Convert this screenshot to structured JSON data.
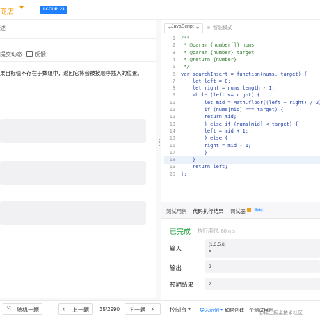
{
  "header": {
    "store_label": "商店",
    "badge": "LCCUP' 23"
  },
  "left": {
    "tab_stub": "述",
    "submissions_tab": "提交动态",
    "feedback_tab": "反馈",
    "description": "果目标值不存在于数组中，返回它将会被按顺序插入的位置。"
  },
  "editor": {
    "language": "JavaScript",
    "smart_mode": "智能模式",
    "lines": [
      {
        "n": "1",
        "text": "/**",
        "cls": "cmt"
      },
      {
        "n": "2",
        "text": " * @param {number[]} nums",
        "cls": "cmt"
      },
      {
        "n": "3",
        "text": " * @param {number} target",
        "cls": "cmt"
      },
      {
        "n": "4",
        "text": " * @return {number}",
        "cls": "cmt"
      },
      {
        "n": "5",
        "text": " */",
        "cls": "cmt"
      },
      {
        "n": "6",
        "text": "var searchInsert = function(nums, target) {",
        "cls": ""
      },
      {
        "n": "7",
        "text": "    let left = 0;",
        "cls": ""
      },
      {
        "n": "8",
        "text": "    let right = nums.length - 1;",
        "cls": ""
      },
      {
        "n": "9",
        "text": "    while (left <= right) {",
        "cls": ""
      },
      {
        "n": "10",
        "text": "        let mid = Math.floor((left + right) / 2);",
        "cls": ""
      },
      {
        "n": "11",
        "text": "        if (nums[mid] === target) {",
        "cls": ""
      },
      {
        "n": "12",
        "text": "        return mid;",
        "cls": ""
      },
      {
        "n": "13",
        "text": "        } else if (nums[mid] < target) {",
        "cls": ""
      },
      {
        "n": "14",
        "text": "        left = mid + 1;",
        "cls": ""
      },
      {
        "n": "15",
        "text": "        } else {",
        "cls": ""
      },
      {
        "n": "16",
        "text": "        right = mid - 1;",
        "cls": ""
      },
      {
        "n": "17",
        "text": "        }",
        "cls": ""
      },
      {
        "n": "18",
        "text": "    }",
        "cls": "hl"
      },
      {
        "n": "19",
        "text": "    return left;",
        "cls": ""
      },
      {
        "n": "20",
        "text": "};",
        "cls": ""
      }
    ]
  },
  "results": {
    "tab_testcase": "测试用例",
    "tab_result": "代码执行结果",
    "tab_debugger": "调试器",
    "beta": "Beta",
    "status": "已完成",
    "exec_time": "执行用时: 80 ms",
    "input_label": "输入",
    "output_label": "输出",
    "expected_label": "预期结果",
    "input_line1": "[1,3,5,6]",
    "input_line2": "5",
    "output_value": "2",
    "expected_value": "2"
  },
  "footer": {
    "random_label": "随机一题",
    "prev_label": "上一题",
    "page_counter": "35/2990",
    "next_label": "下一题",
    "console_label": "控制台",
    "import_example": "导入示例",
    "create_testcase": "如何创建一个测试用例",
    "watermark": "@稀土掘金技术社区"
  }
}
